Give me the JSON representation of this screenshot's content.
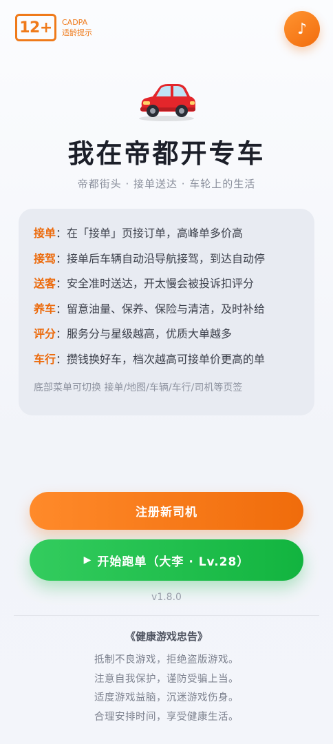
{
  "age_badge": {
    "rating": "12+",
    "org": "CADPA",
    "label": "适龄提示"
  },
  "music": {
    "icon": "music-note-icon",
    "glyph": "♪"
  },
  "hero": {
    "car_icon": "red-car-icon",
    "title": "我在帝都开专车",
    "subtitle": "帝都街头 · 接单送达 · 车轮上的生活"
  },
  "rules": [
    {
      "key": "接单",
      "text": "在「接单」页接订单，高峰单多价高"
    },
    {
      "key": "接驾",
      "text": "接单后车辆自动沿导航接驾，到达自动停"
    },
    {
      "key": "送客",
      "text": "安全准时送达，开太慢会被投诉扣评分"
    },
    {
      "key": "养车",
      "text": "留意油量、保养、保险与清洁，及时补给"
    },
    {
      "key": "评分",
      "text": "服务分与星级越高，优质大单越多"
    },
    {
      "key": "车行",
      "text": "攒钱换好车，档次越高可接单价更高的单"
    }
  ],
  "rule_separator": "：",
  "card_note": "底部菜单可切换 接单/地图/车辆/车行/司机等页签",
  "buttons": {
    "register": "注册新司机",
    "start_icon": "play-icon",
    "start_glyph": "▶",
    "start": "开始跑单（大李 · Lv.28）"
  },
  "version": "v1.8.0",
  "health": {
    "title": "《健康游戏忠告》",
    "lines": [
      "抵制不良游戏，拒绝盗版游戏。",
      "注意自我保护，谨防受骗上当。",
      "适度游戏益脑，沉迷游戏伤身。",
      "合理安排时间，享受健康生活。"
    ]
  },
  "colors": {
    "accent": "#f07a1a",
    "green": "#1fbf4a",
    "card_bg": "#e8ebf2"
  }
}
